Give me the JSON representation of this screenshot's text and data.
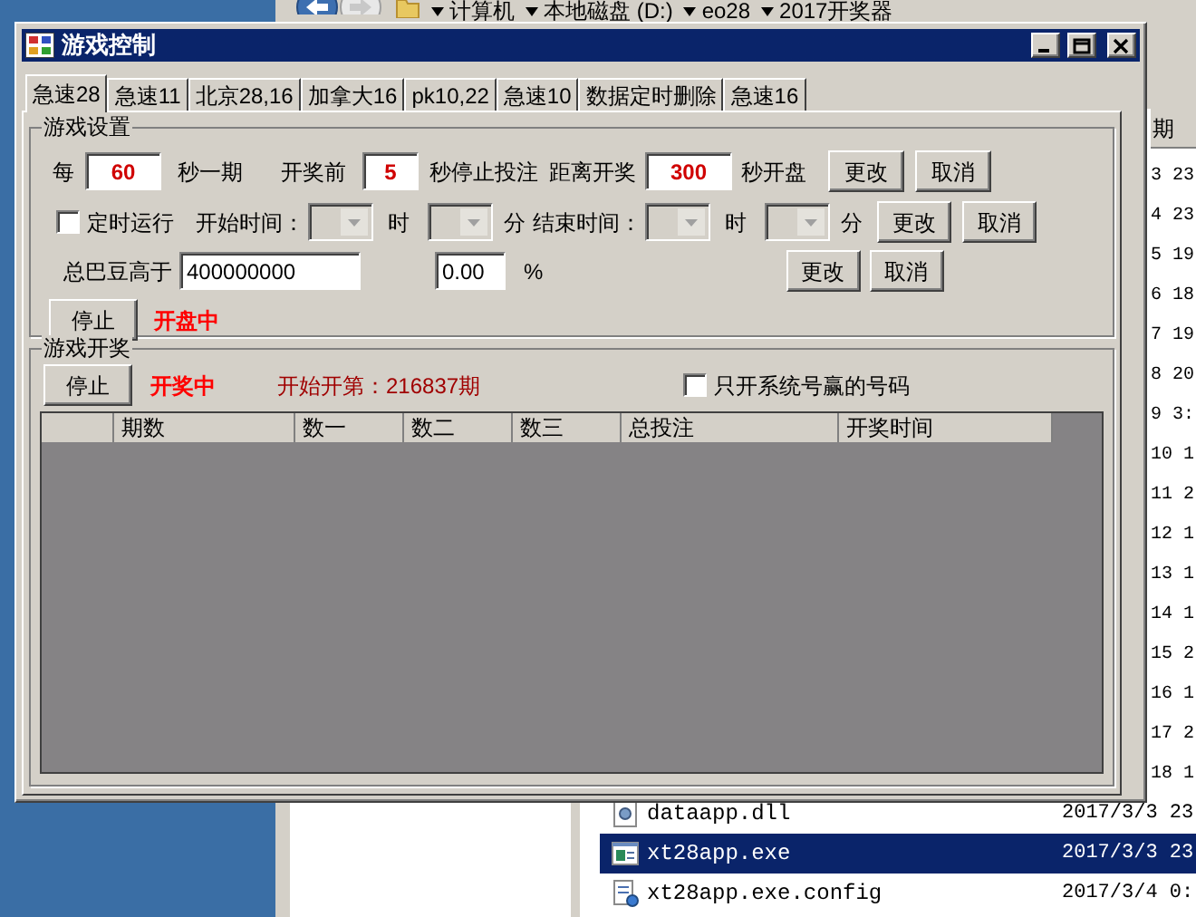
{
  "explorer": {
    "breadcrumb": [
      "计算机",
      "本地磁盘 (D:)",
      "eo28",
      "2017开奖器"
    ],
    "column_header": "期",
    "date_fragments": [
      "3 23",
      "4 23",
      "5 19",
      "6 18",
      "7 19",
      "8 20",
      "9 3:",
      "10 1",
      "11 2",
      "12 1",
      "13 1",
      "14 1",
      "15 2",
      "16 1",
      "17 2",
      "18 1"
    ],
    "files": [
      {
        "kind": "dll",
        "name": "dataapp.dll",
        "date": "2017/3/3 23",
        "selected": false
      },
      {
        "kind": "exe",
        "name": "xt28app.exe",
        "date": "2017/3/3 23",
        "selected": true
      },
      {
        "kind": "config",
        "name": "xt28app.exe.config",
        "date": "2017/3/4 0:",
        "selected": false
      }
    ]
  },
  "dialog": {
    "title": "游戏控制",
    "tabs": [
      {
        "label": "急速28",
        "selected": true
      },
      {
        "label": "急速11",
        "selected": false
      },
      {
        "label": "北京28,16",
        "selected": false
      },
      {
        "label": "加拿大16",
        "selected": false
      },
      {
        "label": "pk10,22",
        "selected": false
      },
      {
        "label": "急速10",
        "selected": false
      },
      {
        "label": "数据定时删除",
        "selected": false
      },
      {
        "label": "急速16",
        "selected": false
      }
    ],
    "settings": {
      "title": "游戏设置",
      "period": {
        "prefix": "每",
        "value": "60",
        "suffix": "秒一期"
      },
      "stop_before": {
        "prefix": "开奖前",
        "value": "5",
        "suffix": "秒停止投注"
      },
      "open_after": {
        "prefix": "距离开奖",
        "value": "300",
        "suffix": "秒开盘"
      },
      "row1_buttons": [
        "更改",
        "取消"
      ],
      "timer": {
        "label": "定时运行",
        "checked": false
      },
      "start": {
        "label": "开始时间：",
        "hour_unit": "时",
        "minute_unit": "分"
      },
      "end": {
        "label": "结束时间：",
        "hour_unit": "时",
        "minute_unit": "分"
      },
      "row2_buttons": [
        "更改",
        "取消"
      ],
      "threshold": {
        "label": "总巴豆高于",
        "value": "400000000"
      },
      "percent": {
        "value": "0.00",
        "unit": "%"
      },
      "row3_buttons": [
        "更改",
        "取消"
      ],
      "stop_button": "停止",
      "status": "开盘中"
    },
    "draw": {
      "title": "游戏开奖",
      "stop_button": "停止",
      "status": "开奖中",
      "info": "开始开第：216837期",
      "only_system": {
        "label": "只开系统号赢的号码",
        "checked": false
      },
      "columns": [
        "期数",
        "数一",
        "数二",
        "数三",
        "总投注",
        "开奖时间"
      ]
    }
  }
}
